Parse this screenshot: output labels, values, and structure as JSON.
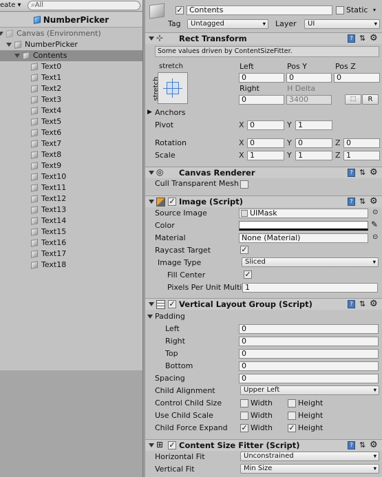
{
  "hierarchy": {
    "create_label": "eate ▾",
    "search_placeholder": "All",
    "title": "NumberPicker",
    "items": [
      {
        "label": "Canvas (Environment)",
        "indent": 0,
        "expanded": true,
        "selected": false,
        "muted": true
      },
      {
        "label": "NumberPicker",
        "indent": 1,
        "expanded": true,
        "selected": false,
        "muted": false
      },
      {
        "label": "Contents",
        "indent": 2,
        "expanded": true,
        "selected": true,
        "muted": false
      },
      {
        "label": "Text0",
        "indent": 3
      },
      {
        "label": "Text1",
        "indent": 3
      },
      {
        "label": "Text2",
        "indent": 3
      },
      {
        "label": "Text3",
        "indent": 3
      },
      {
        "label": "Text4",
        "indent": 3
      },
      {
        "label": "Text5",
        "indent": 3
      },
      {
        "label": "Text6",
        "indent": 3
      },
      {
        "label": "Text7",
        "indent": 3
      },
      {
        "label": "Text8",
        "indent": 3
      },
      {
        "label": "Text9",
        "indent": 3
      },
      {
        "label": "Text10",
        "indent": 3
      },
      {
        "label": "Text11",
        "indent": 3
      },
      {
        "label": "Text12",
        "indent": 3
      },
      {
        "label": "Text13",
        "indent": 3
      },
      {
        "label": "Text14",
        "indent": 3
      },
      {
        "label": "Text15",
        "indent": 3
      },
      {
        "label": "Text16",
        "indent": 3
      },
      {
        "label": "Text17",
        "indent": 3
      },
      {
        "label": "Text18",
        "indent": 3
      }
    ]
  },
  "inspector": {
    "header": {
      "object_name": "Contents",
      "active": true,
      "static_label": "Static",
      "tag_label": "Tag",
      "tag_value": "Untagged",
      "layer_label": "Layer",
      "layer_value": "UI"
    },
    "rect_transform": {
      "title": "Rect Transform",
      "info": "Some values driven by ContentSizeFitter.",
      "anchor_preset_h": "stretch",
      "anchor_preset_v": "stretch",
      "left_label": "Left",
      "left": "0",
      "posy_label": "Pos Y",
      "posy": "0",
      "posz_label": "Pos Z",
      "posz": "0",
      "right_label": "Right",
      "right": "0",
      "hdelta_label": "H Delta",
      "hdelta": "3400",
      "r_button": "R",
      "anchors_label": "Anchors",
      "pivot_label": "Pivot",
      "pivot_x": "0",
      "pivot_y": "1",
      "rotation_label": "Rotation",
      "rot_x": "0",
      "rot_y": "0",
      "rot_z": "0",
      "scale_label": "Scale",
      "scale_x": "1",
      "scale_y": "1",
      "scale_z": "1",
      "x": "X",
      "y": "Y",
      "z": "Z"
    },
    "canvas_renderer": {
      "title": "Canvas Renderer",
      "cull_label": "Cull Transparent Mesh",
      "cull": false
    },
    "image": {
      "title": "Image (Script)",
      "enabled": true,
      "source_label": "Source Image",
      "source": "UIMask",
      "color_label": "Color",
      "color": "#ffffff",
      "material_label": "Material",
      "material": "None (Material)",
      "raycast_label": "Raycast Target",
      "raycast": true,
      "type_label": "Image Type",
      "type": "Sliced",
      "fill_label": "Fill Center",
      "fill": true,
      "ppu_label": "Pixels Per Unit Multi",
      "ppu": "1"
    },
    "vlg": {
      "title": "Vertical Layout Group (Script)",
      "enabled": true,
      "padding_label": "Padding",
      "left_label": "Left",
      "left": "0",
      "right_label": "Right",
      "right": "0",
      "top_label": "Top",
      "top": "0",
      "bottom_label": "Bottom",
      "bottom": "0",
      "spacing_label": "Spacing",
      "spacing": "0",
      "align_label": "Child Alignment",
      "align": "Upper Left",
      "ccs_label": "Control Child Size",
      "ucs_label": "Use Child Scale",
      "cfe_label": "Child Force Expand",
      "width": "Width",
      "height": "Height",
      "ccs_w": false,
      "ccs_h": false,
      "ucs_w": false,
      "ucs_h": false,
      "cfe_w": true,
      "cfe_h": true
    },
    "csf": {
      "title": "Content Size Fitter (Script)",
      "enabled": true,
      "h_label": "Horizontal Fit",
      "h_value": "Unconstrained",
      "v_label": "Vertical Fit",
      "v_value": "Min Size"
    }
  }
}
